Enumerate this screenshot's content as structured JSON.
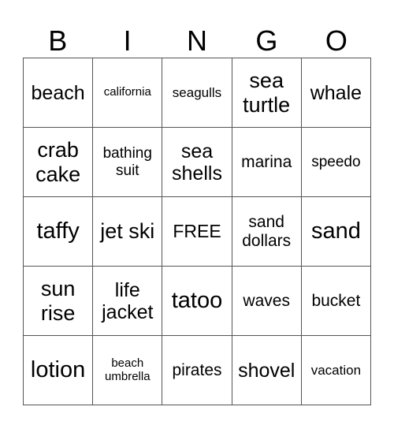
{
  "header": [
    "B",
    "I",
    "N",
    "G",
    "O"
  ],
  "cells": [
    [
      "beach",
      "california",
      "seagulls",
      "sea turtle",
      "whale"
    ],
    [
      "crab cake",
      "bathing suit",
      "sea shells",
      "marina",
      "speedo"
    ],
    [
      "taffy",
      "jet ski",
      "FREE",
      "sand dollars",
      "sand"
    ],
    [
      "sun rise",
      "life jacket",
      "tatoo",
      "waves",
      "bucket"
    ],
    [
      "lotion",
      "beach umbrella",
      "pirates",
      "shovel",
      "vacation"
    ]
  ]
}
